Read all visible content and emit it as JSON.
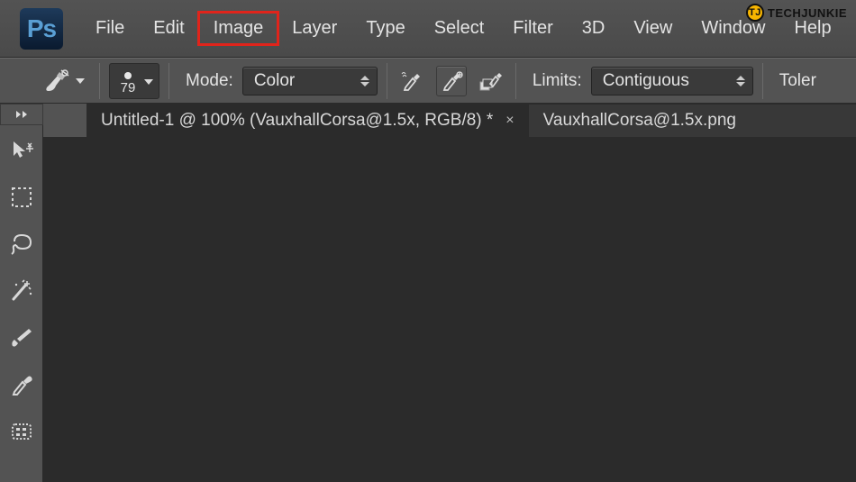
{
  "watermark": {
    "logo_text": "TJ",
    "brand": "TECHJUNKIE"
  },
  "logo": "Ps",
  "menu": {
    "items": [
      "File",
      "Edit",
      "Image",
      "Layer",
      "Type",
      "Select",
      "Filter",
      "3D",
      "View",
      "Window",
      "Help"
    ],
    "highlighted_index": 2
  },
  "options": {
    "brush_size": "79",
    "mode_label": "Mode:",
    "mode_value": "Color",
    "limits_label": "Limits:",
    "limits_value": "Contiguous",
    "tolerance_label": "Toler"
  },
  "tabs": [
    {
      "title": "Untitled-1 @ 100% (VauxhallCorsa@1.5x, RGB/8) *",
      "active": true
    },
    {
      "title": "VauxhallCorsa@1.5x.png",
      "active": false
    }
  ],
  "tools": [
    "move",
    "marquee",
    "lasso",
    "magic-wand",
    "brush",
    "eyedropper",
    "pattern"
  ]
}
